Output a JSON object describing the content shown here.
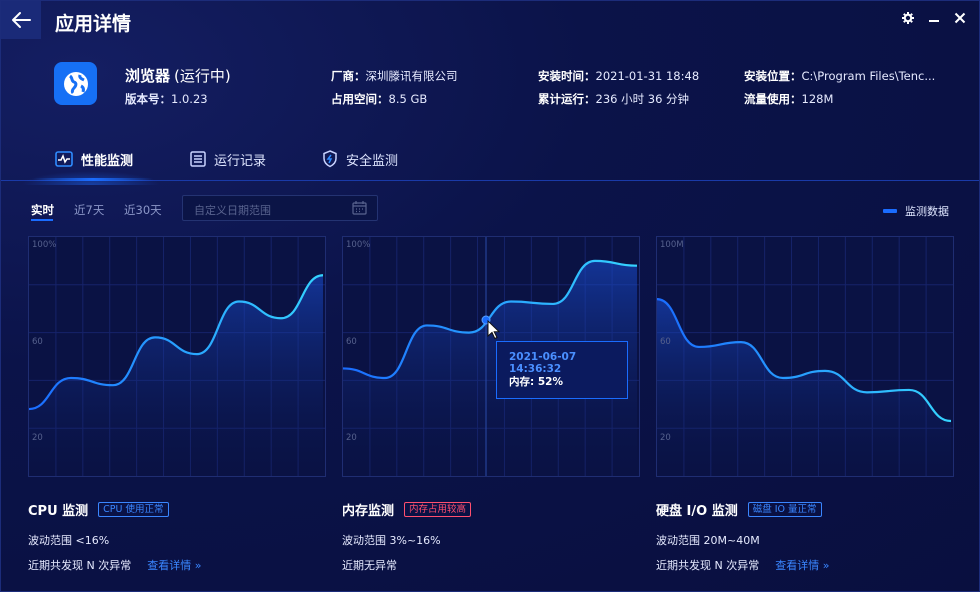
{
  "window": {
    "title": "应用详情",
    "controls": [
      "gear-icon",
      "minimize-icon",
      "close-icon"
    ]
  },
  "app": {
    "name": "浏览器",
    "status": "(运行中)",
    "version_label": "版本号：",
    "version": "1.0.23"
  },
  "info": {
    "vendor_label": "厂商：",
    "vendor": "深圳滕讯有限公司",
    "space_label": "占用空间：",
    "space": "8.5 GB",
    "install_time_label": "安装时间：",
    "install_time": "2021-01-31 18:48",
    "runtime_label": "累计运行：",
    "runtime": "236 小时 36 分钟",
    "location_label": "安装位置：",
    "location": "C:\\Program Files\\Tenc...",
    "traffic_label": "流量使用：",
    "traffic": "128M"
  },
  "tabs": [
    {
      "label": "性能监测",
      "icon": "pulse-icon",
      "active": true
    },
    {
      "label": "运行记录",
      "icon": "log-icon",
      "active": false
    },
    {
      "label": "安全监测",
      "icon": "shield-icon",
      "active": false
    }
  ],
  "filters": {
    "realtime": "实时",
    "seven_days": "近7天",
    "thirty_days": "近30天",
    "date_placeholder": "自定义日期范围"
  },
  "legend": {
    "label": "监测数据",
    "color": "#1a6cff"
  },
  "colors": {
    "accent": "#1a6cff",
    "line_end": "#35d4ff",
    "warn": "#ff4f6f"
  },
  "chart_data": [
    {
      "type": "area",
      "y_ticks": [
        "100%",
        "60",
        "20"
      ],
      "ylim": [
        0,
        100
      ],
      "x": [
        0,
        1,
        2,
        3,
        4,
        5,
        6,
        7,
        8,
        9,
        10
      ],
      "values": [
        28,
        41,
        38,
        58,
        51,
        73,
        66,
        84
      ]
    },
    {
      "type": "area",
      "y_ticks": [
        "100%",
        "60",
        "20"
      ],
      "ylim": [
        0,
        100
      ],
      "values": [
        45,
        41,
        63,
        60,
        73,
        72,
        90,
        88
      ],
      "tooltip": {
        "time": "2021-06-07 14:36:32",
        "text": "内存: 52%"
      }
    },
    {
      "type": "area",
      "y_ticks": [
        "100M",
        "60",
        "20"
      ],
      "ylim": [
        0,
        100
      ],
      "values": [
        74,
        54,
        56,
        41,
        44,
        35,
        36,
        23
      ]
    }
  ],
  "sections": [
    {
      "title": "CPU 监测",
      "badge": "CPU 使用正常",
      "badge_style": "blue",
      "range": "波动范围 <16%",
      "anomaly": "近期共发现 N 次异常",
      "link": "查看详情 »"
    },
    {
      "title": "内存监测",
      "badge": "内存占用较高",
      "badge_style": "red",
      "range": "波动范围 3%~16%",
      "anomaly": "近期无异常",
      "link": ""
    },
    {
      "title": "硬盘 I/O 监测",
      "badge": "磁盘 IO 量正常",
      "badge_style": "blue",
      "range": "波动范围 20M~40M",
      "anomaly": "近期共发现 N 次异常",
      "link": "查看详情 »"
    }
  ]
}
